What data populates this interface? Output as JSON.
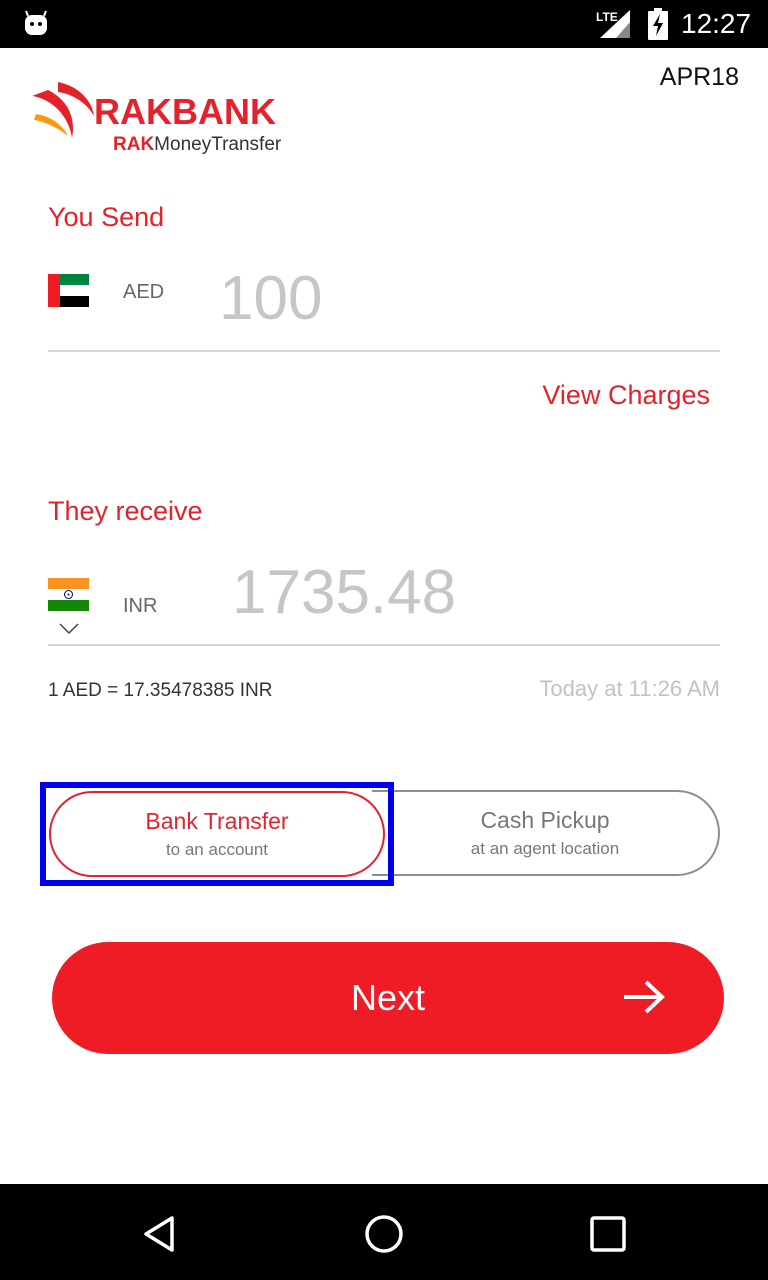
{
  "status_bar": {
    "time": "12:27",
    "network": "LTE"
  },
  "header": {
    "version": "APR18",
    "logo_bank": "RAKBANK",
    "logo_sub_brand": "RAK",
    "logo_sub_rest": "MoneyTransfer"
  },
  "send": {
    "label": "You Send",
    "currency": "AED",
    "amount": "100",
    "flag_icon": "uae-flag-icon"
  },
  "view_charges": "View Charges",
  "receive": {
    "label": "They receive",
    "currency": "INR",
    "amount": "1735.48",
    "flag_icon": "india-flag-icon"
  },
  "rate": {
    "text": "1 AED = 17.35478385 INR",
    "updated": "Today at 11:26 AM"
  },
  "transfer_options": [
    {
      "title": "Bank Transfer",
      "subtitle": "to an account",
      "selected": true
    },
    {
      "title": "Cash Pickup",
      "subtitle": "at an agent location",
      "selected": false
    }
  ],
  "next_button": {
    "label": "Next"
  },
  "colors": {
    "brand_red": "#e3222c",
    "button_red": "#ee1c25",
    "highlight_blue": "#0000ee"
  }
}
